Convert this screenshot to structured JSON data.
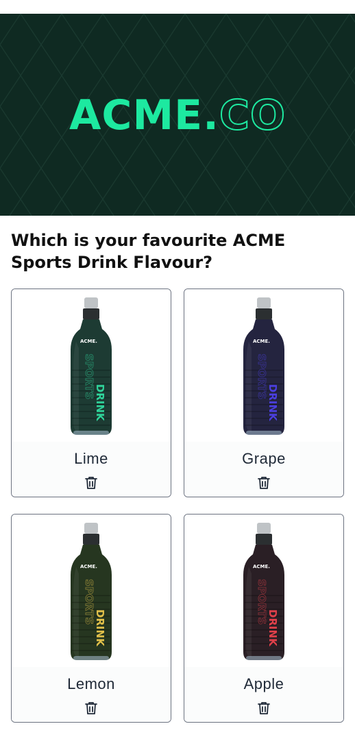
{
  "banner": {
    "logo_main": "ACME.",
    "logo_suffix": "CO",
    "background_color": "#0f2a22",
    "accent_color": "#1de9a0"
  },
  "question": "Which is your favourite ACME Sports Drink Flavour?",
  "options": [
    {
      "label": "Lime",
      "accent": "#2fd39a",
      "body": "#1d3b33",
      "brand": "ACME.",
      "side_text": "SPORTS DRINK",
      "icon": "trash-icon"
    },
    {
      "label": "Grape",
      "accent": "#4b3fe0",
      "body": "#24243f",
      "brand": "ACME.",
      "side_text": "SPORTS DRINK",
      "icon": "trash-icon"
    },
    {
      "label": "Lemon",
      "accent": "#e0bf4a",
      "body": "#263620",
      "brand": "ACME.",
      "side_text": "SPORTS DRINK",
      "icon": "trash-icon"
    },
    {
      "label": "Apple",
      "accent": "#e0404a",
      "body": "#2a1f25",
      "brand": "ACME.",
      "side_text": "SPORTS DRINK",
      "icon": "trash-icon"
    }
  ]
}
